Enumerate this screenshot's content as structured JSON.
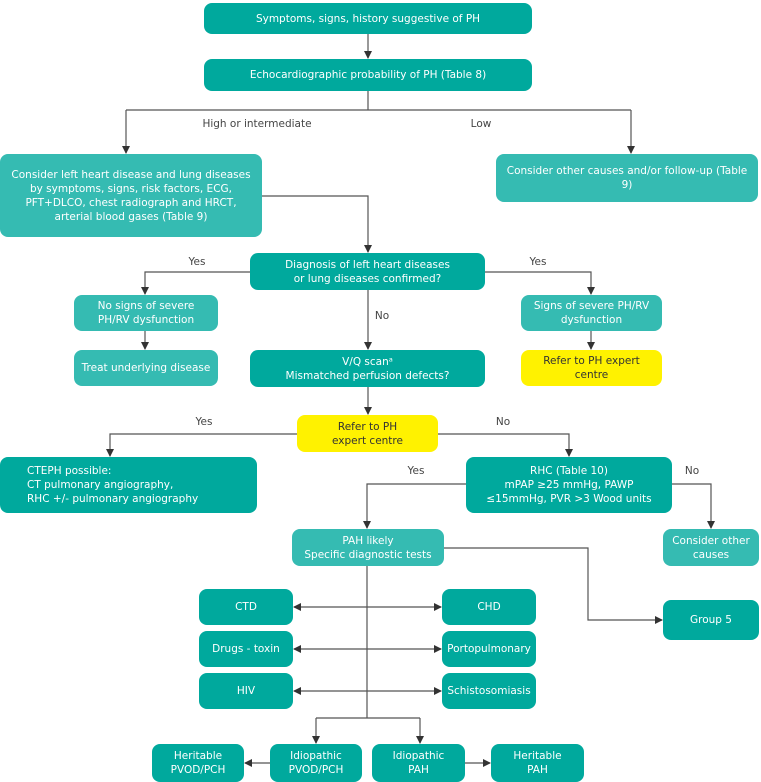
{
  "colors": {
    "primary": "#00a99d",
    "secondary": "#35bbb2",
    "highlight": "#fff200",
    "connector": "#555555"
  },
  "nodes": {
    "symptoms": "Symptoms, signs, history suggestive of PH",
    "echo": "Echocardiographic probability of PH (Table 8)",
    "consider_left": "Consider left heart disease and lung diseases\nby symptoms, signs, risk factors, ECG,\nPFT+DLCO, chest radiograph and HRCT,\narterial blood gases (Table 9)",
    "consider_other_followup": "Consider other causes and/or follow-up (Table 9)",
    "diagnosis_confirmed": "Diagnosis of left heart diseases\nor lung diseases confirmed?",
    "no_signs_severe": "No signs of severe\nPH/RV dysfunction",
    "signs_severe": "Signs of severe PH/RV\ndysfunction",
    "treat_underlying": "Treat underlying disease",
    "refer_expert_1": "Refer to PH expert centre",
    "vq_scan": "V/Q scanᵃ\nMismatched perfusion defects?",
    "refer_expert_2": "Refer to PH\nexpert centre",
    "cteph": "CTEPH possible:\nCT pulmonary angiography,\nRHC +/- pulmonary angiography",
    "rhc": "RHC (Table 10)\nmPAP ≥25 mmHg, PAWP\n≤15mmHg, PVR >3 Wood units",
    "pah_likely": "PAH likely\nSpecific diagnostic tests",
    "consider_other_causes": "Consider other\ncauses",
    "group5": "Group 5",
    "ctd": "CTD",
    "chd": "CHD",
    "drugs": "Drugs - toxin",
    "portopulmonary": "Portopulmonary",
    "hiv": "HIV",
    "schisto": "Schistosomiasis",
    "heritable_pvod": "Heritable\nPVOD/PCH",
    "idiopathic_pvod": "Idiopathic\nPVOD/PCH",
    "idiopathic_pah": "Idiopathic\nPAH",
    "heritable_pah": "Heritable\nPAH"
  },
  "edge_labels": {
    "high_intermediate": "High or intermediate",
    "low": "Low",
    "yes_left_1": "Yes",
    "yes_right_1": "Yes",
    "no_1": "No",
    "yes_2": "Yes",
    "no_2": "No",
    "yes_3": "Yes",
    "no_3": "No"
  }
}
